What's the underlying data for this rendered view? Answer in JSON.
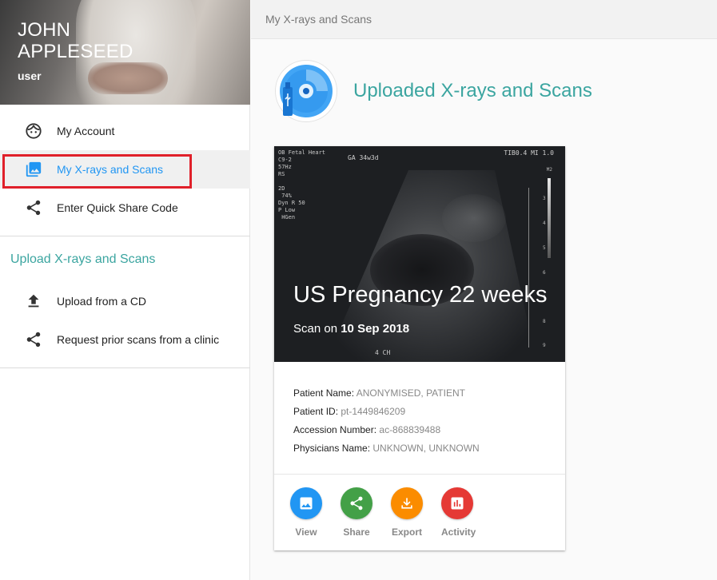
{
  "sidebar": {
    "profile": {
      "first_name": "JOHN",
      "last_name": "APPLESEED",
      "role": "user"
    },
    "menu": [
      {
        "label": "My Account",
        "icon": "face-icon"
      },
      {
        "label": "My X-rays and Scans",
        "icon": "photo-library-icon",
        "active": true
      },
      {
        "label": "Enter Quick Share Code",
        "icon": "share-icon"
      }
    ],
    "upload_heading": "Upload X-rays and Scans",
    "upload_menu": [
      {
        "label": "Upload from a CD",
        "icon": "upload-icon"
      },
      {
        "label": "Request prior scans from a clinic",
        "icon": "share-icon"
      }
    ],
    "active_color": "#2196f3",
    "highlight_color": "#e0202a"
  },
  "topbar": {
    "breadcrumb": "My X-rays and Scans"
  },
  "main": {
    "title": "Uploaded X-rays and Scans",
    "title_color": "#3ba5a0",
    "card": {
      "image_overlay": {
        "top_left": "OB Fetal Heart\nC9-2\n57Hz\nRS\n\n2D\n 74%\nDyn R 50\nP Low\n HGen",
        "ga": "GA  34w3d",
        "top_right": "TIB0.4  MI 1.0",
        "m2": "M2",
        "bottom_label": "4 CH",
        "scale_ticks": [
          "2",
          "3",
          "4",
          "5",
          "6",
          "7",
          "8",
          "9"
        ]
      },
      "scan_title": "US Pregnancy 22 weeks",
      "scan_on_label": "Scan on",
      "scan_date": "10 Sep 2018",
      "details": [
        {
          "key": "Patient Name:",
          "value": "ANONYMISED, PATIENT"
        },
        {
          "key": "Patient ID:",
          "value": "pt-1449846209"
        },
        {
          "key": "Accession Number:",
          "value": "ac-868839488"
        },
        {
          "key": "Physicians Name:",
          "value": "UNKNOWN, UNKNOWN"
        }
      ],
      "actions": [
        {
          "label": "View",
          "color": "#2196f3",
          "icon": "image-icon"
        },
        {
          "label": "Share",
          "color": "#43a047",
          "icon": "share-icon"
        },
        {
          "label": "Export",
          "color": "#fb8c00",
          "icon": "download-icon"
        },
        {
          "label": "Activity",
          "color": "#e53935",
          "icon": "bar-chart-icon"
        }
      ]
    }
  }
}
